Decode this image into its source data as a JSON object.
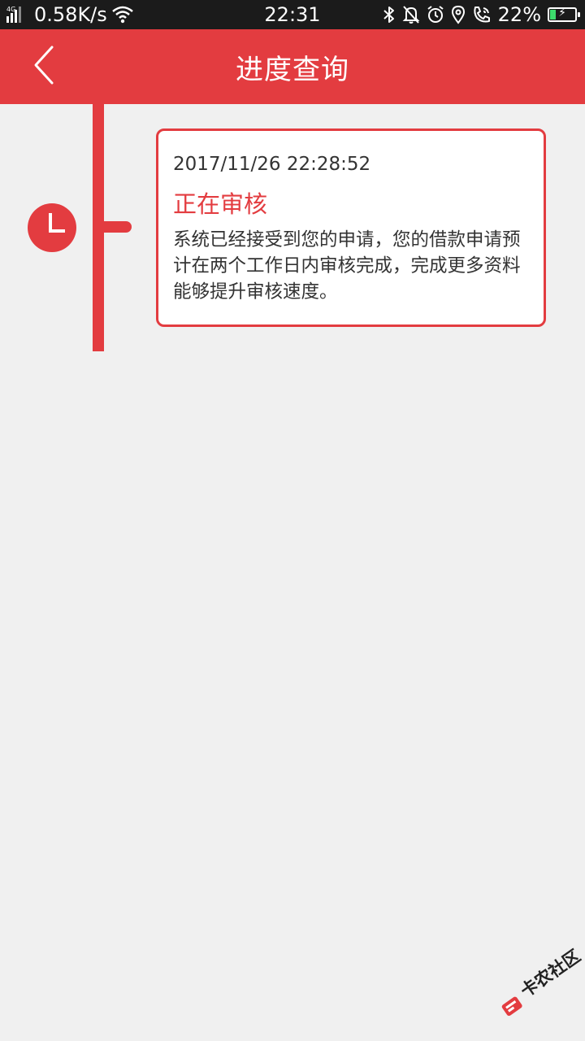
{
  "status_bar": {
    "network_type": "4G",
    "net_speed": "0.58K/s",
    "time": "22:31",
    "battery_percent": "22%",
    "battery_level": 0.22,
    "icons": [
      "signal-icon",
      "wifi-icon",
      "bluetooth-icon",
      "mute-icon",
      "alarm-icon",
      "location-icon",
      "call-icon",
      "battery-icon"
    ]
  },
  "header": {
    "title": "进度查询",
    "background_color": "#e33c40",
    "back_icon": "chevron-left-icon"
  },
  "timeline": {
    "accent_color": "#e33c40",
    "node_icon": "clock-icon",
    "entries": [
      {
        "time": "2017/11/26 22:28:52",
        "status": "正在审核",
        "description": "系统已经接受到您的申请，您的借款申请预计在两个工作日内审核完成，完成更多资料能够提升审核速度。"
      }
    ]
  },
  "watermark": {
    "text": "卡农社区",
    "icon": "card-logo-icon"
  }
}
